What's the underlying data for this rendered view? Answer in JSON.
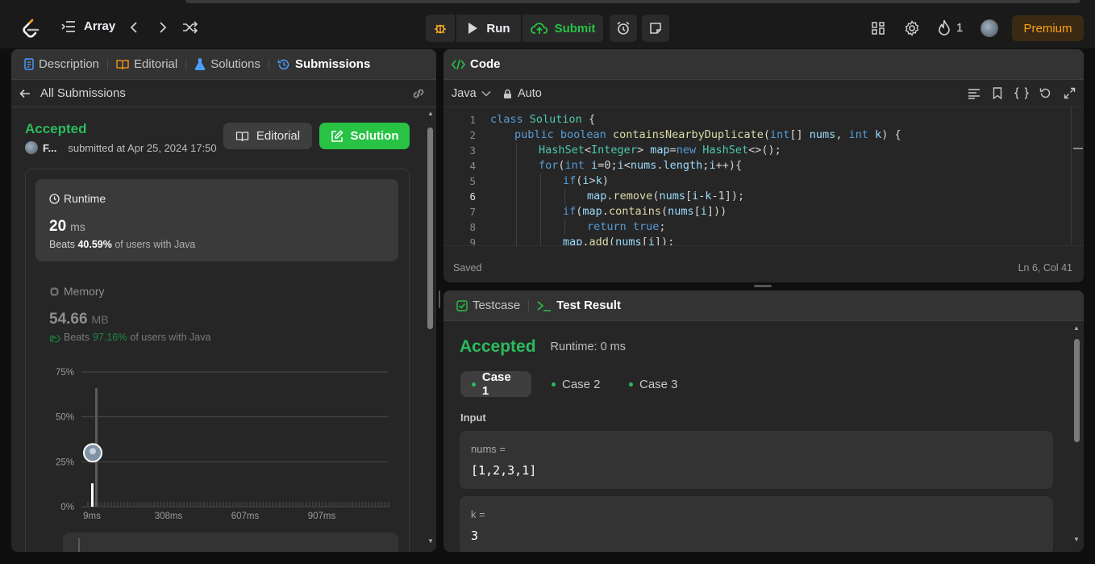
{
  "topbar": {
    "problem_list": "Array",
    "run": "Run",
    "submit": "Submit",
    "streak": "1",
    "premium": "Premium"
  },
  "left_tabs": [
    {
      "label": "Description"
    },
    {
      "label": "Editorial"
    },
    {
      "label": "Solutions"
    },
    {
      "label": "Submissions"
    }
  ],
  "submission": {
    "back_label": "All Submissions",
    "status": "Accepted",
    "user": "F...",
    "submitted_at": "submitted at Apr 25, 2024 17:50",
    "editorial_btn": "Editorial",
    "solution_btn": "Solution",
    "runtime": {
      "title": "Runtime",
      "value": "20",
      "unit": "ms",
      "beats_prefix": "Beats",
      "beats_pct": "40.59%",
      "beats_suffix": "of users with Java"
    },
    "memory": {
      "title": "Memory",
      "value": "54.66",
      "unit": "MB",
      "beats_prefix": "Beats",
      "beats_pct": "97.16%",
      "beats_suffix": "of users with Java"
    }
  },
  "chart_data": {
    "type": "bar",
    "title": "",
    "ylabel": "",
    "xlabel": "",
    "y_ticks": [
      "75%",
      "50%",
      "25%",
      "0%"
    ],
    "x_ticks": [
      "9ms",
      "308ms",
      "607ms",
      "907ms"
    ],
    "ylim": [
      0,
      75
    ],
    "bars": [
      {
        "x": "9ms",
        "value": 13
      },
      {
        "x": "20ms",
        "value": 66
      }
    ],
    "marker": {
      "x": "20ms",
      "value": 30
    }
  },
  "code_panel": {
    "title": "Code",
    "language": "Java",
    "auto": "Auto",
    "status": "Saved",
    "cursor": "Ln 6, Col 41",
    "lines": [
      {
        "n": "1",
        "indent": 0,
        "tokens": [
          [
            "kw",
            "class "
          ],
          [
            "ty",
            "Solution"
          ],
          [
            "pl",
            " {"
          ]
        ]
      },
      {
        "n": "2",
        "indent": 1,
        "tokens": [
          [
            "kw",
            "public "
          ],
          [
            "kw",
            "boolean "
          ],
          [
            "fn",
            "containsNearbyDuplicate"
          ],
          [
            "pl",
            "("
          ],
          [
            "kw",
            "int"
          ],
          [
            "pl",
            "[] "
          ],
          [
            "vr",
            "nums"
          ],
          [
            "pl",
            ", "
          ],
          [
            "kw",
            "int "
          ],
          [
            "vr",
            "k"
          ],
          [
            "pl",
            ") {"
          ]
        ]
      },
      {
        "n": "3",
        "indent": 2,
        "tokens": [
          [
            "ty",
            "HashSet"
          ],
          [
            "pl",
            "<"
          ],
          [
            "ty",
            "Integer"
          ],
          [
            "pl",
            "> "
          ],
          [
            "vr",
            "map"
          ],
          [
            "pl",
            "="
          ],
          [
            "kw",
            "new "
          ],
          [
            "ty",
            "HashSet"
          ],
          [
            "pl",
            "<>();"
          ]
        ]
      },
      {
        "n": "4",
        "indent": 2,
        "tokens": [
          [
            "kw",
            "for"
          ],
          [
            "pl",
            "("
          ],
          [
            "kw",
            "int "
          ],
          [
            "vr",
            "i"
          ],
          [
            "pl",
            "=0;"
          ],
          [
            "vr",
            "i"
          ],
          [
            "pl",
            "<"
          ],
          [
            "vr",
            "nums"
          ],
          [
            "pl",
            "."
          ],
          [
            "vr",
            "length"
          ],
          [
            "pl",
            ";"
          ],
          [
            "vr",
            "i"
          ],
          [
            "pl",
            "++){"
          ]
        ]
      },
      {
        "n": "5",
        "indent": 3,
        "tokens": [
          [
            "kw",
            "if"
          ],
          [
            "pl",
            "("
          ],
          [
            "vr",
            "i"
          ],
          [
            "pl",
            ">"
          ],
          [
            "vr",
            "k"
          ],
          [
            "pl",
            ")"
          ]
        ]
      },
      {
        "n": "6",
        "indent": 4,
        "tokens": [
          [
            "vr",
            "map"
          ],
          [
            "pl",
            "."
          ],
          [
            "fn",
            "remove"
          ],
          [
            "pl",
            "("
          ],
          [
            "vr",
            "nums"
          ],
          [
            "pl",
            "["
          ],
          [
            "vr",
            "i"
          ],
          [
            "pl",
            "-"
          ],
          [
            "vr",
            "k"
          ],
          [
            "pl",
            "-1]);"
          ]
        ]
      },
      {
        "n": "7",
        "indent": 3,
        "tokens": [
          [
            "kw",
            "if"
          ],
          [
            "pl",
            "("
          ],
          [
            "vr",
            "map"
          ],
          [
            "pl",
            "."
          ],
          [
            "fn",
            "contains"
          ],
          [
            "pl",
            "("
          ],
          [
            "vr",
            "nums"
          ],
          [
            "pl",
            "["
          ],
          [
            "vr",
            "i"
          ],
          [
            "pl",
            "]))"
          ]
        ]
      },
      {
        "n": "8",
        "indent": 4,
        "tokens": [
          [
            "kw",
            "return "
          ],
          [
            "kw",
            "true"
          ],
          [
            "pl",
            ";"
          ]
        ]
      },
      {
        "n": "9",
        "indent": 3,
        "tokens": [
          [
            "vr",
            "map"
          ],
          [
            "pl",
            "."
          ],
          [
            "fn",
            "add"
          ],
          [
            "pl",
            "("
          ],
          [
            "vr",
            "nums"
          ],
          [
            "pl",
            "["
          ],
          [
            "vr",
            "i"
          ],
          [
            "pl",
            "]);"
          ]
        ]
      }
    ]
  },
  "result_panel": {
    "tab_testcase": "Testcase",
    "tab_result": "Test Result",
    "status": "Accepted",
    "runtime": "Runtime: 0 ms",
    "cases": [
      "Case 1",
      "Case 2",
      "Case 3"
    ],
    "input_label": "Input",
    "inputs": [
      {
        "name": "nums =",
        "value": "[1,2,3,1]"
      },
      {
        "name": "k =",
        "value": "3"
      }
    ]
  },
  "colors": {
    "accepted": "#2cbb5d",
    "submit": "#28c244",
    "premium": "#ffa116",
    "active_tab_icon": "#4a9eff"
  }
}
